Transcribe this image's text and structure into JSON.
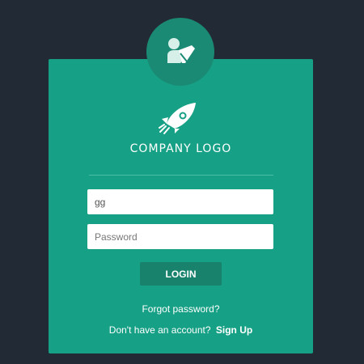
{
  "header": {
    "avatar_icon": "user-edit-icon",
    "logo_icon": "rocket-icon",
    "logo_text": "COMPANY LOGO"
  },
  "form": {
    "username_value": "gg",
    "password_placeholder": "Password",
    "login_label": "LOGIN"
  },
  "links": {
    "forgot_password": "Forgot password?",
    "no_account_text": "Don't have an account?",
    "signup_label": "Sign Up"
  },
  "colors": {
    "background": "#222a35",
    "card": "#16a085",
    "accent_dark": "#18826d",
    "text": "#ffffff"
  }
}
